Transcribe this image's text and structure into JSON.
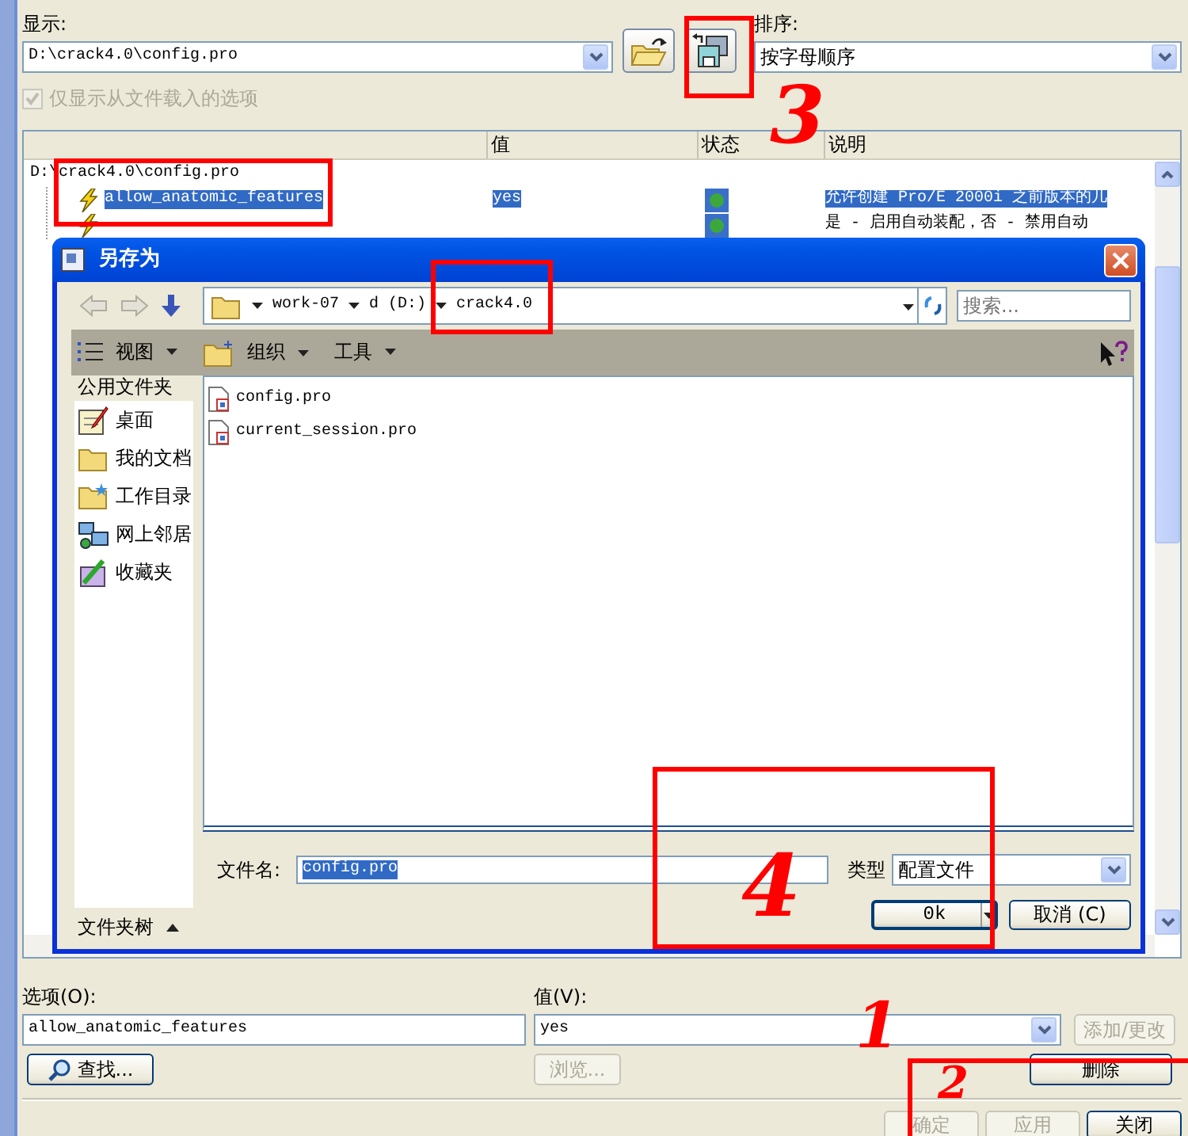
{
  "display": {
    "label": "显示:",
    "value": "D:\\crack4.0\\config.pro"
  },
  "sort": {
    "label": "排序:",
    "value": "按字母顺序"
  },
  "only_loaded": {
    "label": "仅显示从文件载入的选项",
    "checked": true,
    "disabled": true
  },
  "table": {
    "columns": [
      "值",
      "状态",
      "说明"
    ],
    "root": {
      "label": "D:\\crack4.0\\config.pro",
      "children": [
        {
          "name": "allow_anatomic_features",
          "value": "yes",
          "status": true,
          "description": "允许创建 Pro/E 2000i 之前版本的几",
          "selected": true
        },
        {
          "status": true,
          "description": "是 - 启用自动装配，否 - 禁用自动",
          "selected": false
        }
      ]
    }
  },
  "option": {
    "label": "选项(O):",
    "value": "allow_anatomic_features"
  },
  "value_field": {
    "label": "值(V):",
    "value": "yes"
  },
  "buttons": [
    {
      "label": "添加/更改",
      "disabled": true
    },
    {
      "label": "查找...",
      "disabled": false
    },
    {
      "label": "浏览...",
      "disabled": true
    },
    {
      "label": "删除",
      "disabled": false
    }
  ],
  "bottom_buttons": [
    {
      "label": "确定",
      "disabled": true
    },
    {
      "label": "应用",
      "disabled": true
    },
    {
      "label": "关闭",
      "disabled": false
    }
  ],
  "save_dialog": {
    "title": "另存为",
    "path": [
      "work-07",
      "d (D:)",
      "crack4.0"
    ],
    "search": {
      "placeholder": "搜索..."
    },
    "toolbar": [
      "视图",
      "组织",
      "工具"
    ],
    "places_title": "公用文件夹",
    "places": [
      "桌面",
      "我的文档",
      "工作目录",
      "网上邻居",
      "收藏夹"
    ],
    "folder_tree": "文件夹树",
    "files": [
      "config.pro",
      "current_session.pro"
    ],
    "filename": {
      "label": "文件名:",
      "value": "config.pro"
    },
    "type": {
      "label": "类型",
      "value": "配置文件"
    },
    "ok": "0k",
    "cancel": "取消 (C)"
  },
  "annotations": [
    {
      "kind": "box"
    },
    {
      "kind": "box"
    },
    {
      "kind": "number",
      "label": "3"
    },
    {
      "kind": "box"
    },
    {
      "kind": "box"
    },
    {
      "kind": "number",
      "label": "4"
    },
    {
      "kind": "number",
      "label": "1"
    },
    {
      "kind": "box"
    },
    {
      "kind": "number",
      "label": "2"
    }
  ]
}
